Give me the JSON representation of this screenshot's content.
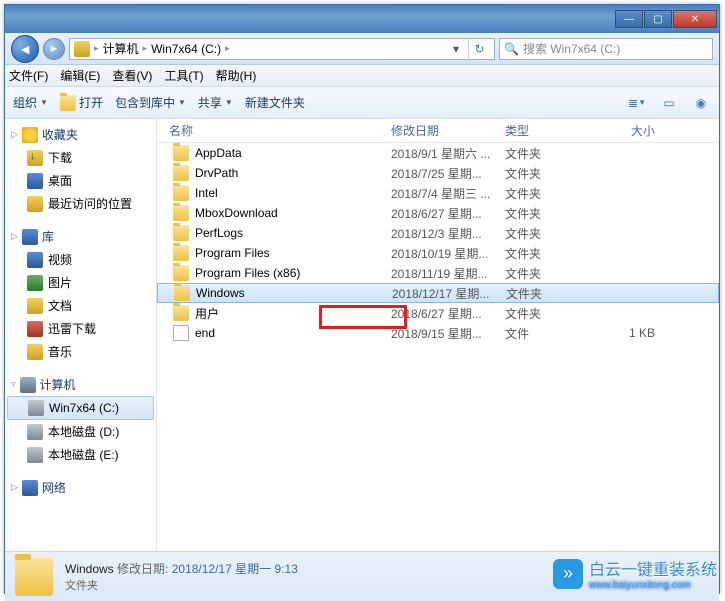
{
  "titlebar": {
    "min": "—",
    "max": "▢",
    "close": "✕"
  },
  "nav": {
    "crumb1": "计算机",
    "crumb2": "Win7x64 (C:)",
    "search_placeholder": "搜索 Win7x64 (C:)"
  },
  "menubar": {
    "file": "文件(F)",
    "edit": "编辑(E)",
    "view": "查看(V)",
    "tools": "工具(T)",
    "help": "帮助(H)"
  },
  "toolbar": {
    "org": "组织",
    "open": "打开",
    "include": "包含到库中",
    "share": "共享",
    "newfolder": "新建文件夹"
  },
  "sidebar": {
    "fav": "收藏夹",
    "download": "下载",
    "desktop": "桌面",
    "recent": "最近访问的位置",
    "lib": "库",
    "video": "视频",
    "pic": "图片",
    "doc": "文档",
    "xl": "迅雷下载",
    "music": "音乐",
    "computer": "计算机",
    "drive_c": "Win7x64 (C:)",
    "drive_d": "本地磁盘 (D:)",
    "drive_e": "本地磁盘 (E:)",
    "network": "网络"
  },
  "columns": {
    "name": "名称",
    "date": "修改日期",
    "type": "类型",
    "size": "大小"
  },
  "files": [
    {
      "name": "AppData",
      "date": "2018/9/1 星期六 ...",
      "type": "文件夹",
      "size": "",
      "icon": "folder"
    },
    {
      "name": "DrvPath",
      "date": "2018/7/25 星期...",
      "type": "文件夹",
      "size": "",
      "icon": "folder"
    },
    {
      "name": "Intel",
      "date": "2018/7/4 星期三 ...",
      "type": "文件夹",
      "size": "",
      "icon": "folder"
    },
    {
      "name": "MboxDownload",
      "date": "2018/6/27 星期...",
      "type": "文件夹",
      "size": "",
      "icon": "folder"
    },
    {
      "name": "PerfLogs",
      "date": "2018/12/3 星期...",
      "type": "文件夹",
      "size": "",
      "icon": "folder"
    },
    {
      "name": "Program Files",
      "date": "2018/10/19 星期...",
      "type": "文件夹",
      "size": "",
      "icon": "folder"
    },
    {
      "name": "Program Files (x86)",
      "date": "2018/11/19 星期...",
      "type": "文件夹",
      "size": "",
      "icon": "folder"
    },
    {
      "name": "Windows",
      "date": "2018/12/17 星期...",
      "type": "文件夹",
      "size": "",
      "icon": "folder",
      "selected": true
    },
    {
      "name": "用户",
      "date": "2018/6/27 星期...",
      "type": "文件夹",
      "size": "",
      "icon": "folder"
    },
    {
      "name": "end",
      "date": "2018/9/15 星期...",
      "type": "文件",
      "size": "1 KB",
      "icon": "file"
    }
  ],
  "status": {
    "name": "Windows",
    "label_date": "修改日期:",
    "date": "2018/12/17 星期一 9:13",
    "type": "文件夹"
  },
  "watermark": {
    "text": "白云一键重装系统",
    "sub": "www.baiyunxitong.com"
  }
}
